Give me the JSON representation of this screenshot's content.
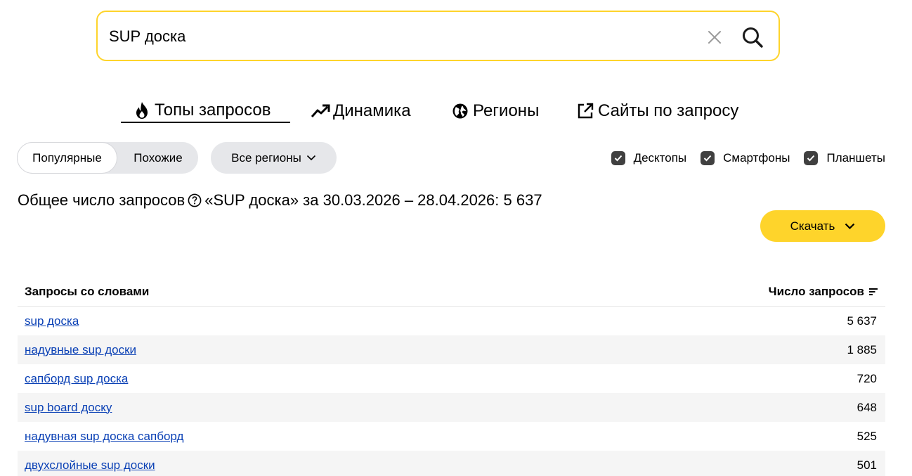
{
  "search": {
    "value": "SUP доска",
    "clear_icon": "close-icon",
    "search_icon": "search-icon"
  },
  "tabs": [
    {
      "label": "Топы запросов",
      "icon": "fire-icon",
      "active": true
    },
    {
      "label": "Динамика",
      "icon": "trend-icon",
      "active": false
    },
    {
      "label": "Регионы",
      "icon": "globe-icon",
      "active": false
    },
    {
      "label": "Сайты по запросу",
      "icon": "external-link-icon",
      "active": false
    }
  ],
  "filters": {
    "segments": [
      {
        "label": "Популярные",
        "selected": true
      },
      {
        "label": "Похожие",
        "selected": false
      }
    ],
    "region": "Все регионы",
    "devices": [
      {
        "label": "Десктопы",
        "checked": true
      },
      {
        "label": "Смартфоны",
        "checked": true
      },
      {
        "label": "Планшеты",
        "checked": true
      }
    ]
  },
  "summary": {
    "prefix": "Общее число запросов",
    "suffix": "«SUP доска» за 30.03.2026 – 28.04.2026: 5 637"
  },
  "download_label": "Скачать",
  "table": {
    "col_query": "Запросы со словами",
    "col_count": "Число запросов",
    "rows": [
      {
        "query": "sup доска",
        "count": "5 637"
      },
      {
        "query": "надувные sup доски",
        "count": "1 885"
      },
      {
        "query": "сапборд sup доска",
        "count": "720"
      },
      {
        "query": "sup board доску",
        "count": "648"
      },
      {
        "query": "надувная sup доска сапборд",
        "count": "525"
      },
      {
        "query": "двухслойные sup доски",
        "count": "501"
      }
    ]
  },
  "colors": {
    "accent": "#fed42b",
    "link": "#0a40b5",
    "checkbox": "#404040",
    "pill_bg": "#e6e7ea"
  }
}
